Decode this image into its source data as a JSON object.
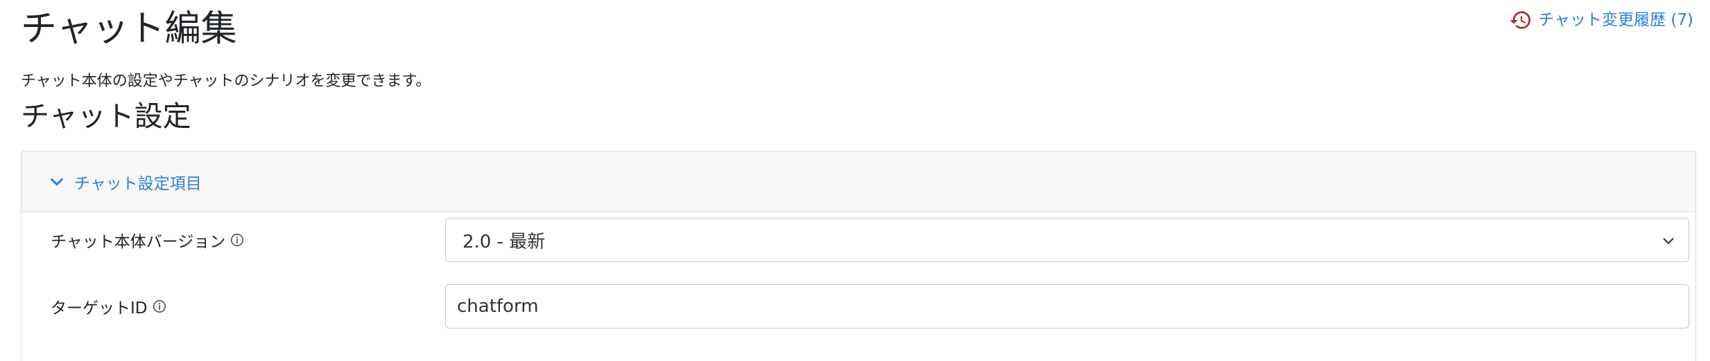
{
  "page": {
    "title": "チャット編集",
    "description": "チャット本体の設定やチャットのシナリオを変更できます。"
  },
  "history_link": {
    "label": "チャット変更履歴 (7)",
    "icon": "history-icon",
    "icon_color": "#a83232"
  },
  "section": {
    "title": "チャット設定"
  },
  "card": {
    "header_label": "チャット設定項目",
    "header_icon": "chevron-down-icon",
    "fields": [
      {
        "label": "チャット本体バージョン",
        "info_icon": "info-icon",
        "type": "select",
        "value": "2.0 - 最新"
      },
      {
        "label": "ターゲットID",
        "info_icon": "info-icon",
        "type": "input",
        "value": "chatform"
      }
    ]
  },
  "colors": {
    "link": "#2f80d6",
    "text": "#212529",
    "card_header_bg": "#f7f7f7",
    "border": "#dcdcdc"
  }
}
